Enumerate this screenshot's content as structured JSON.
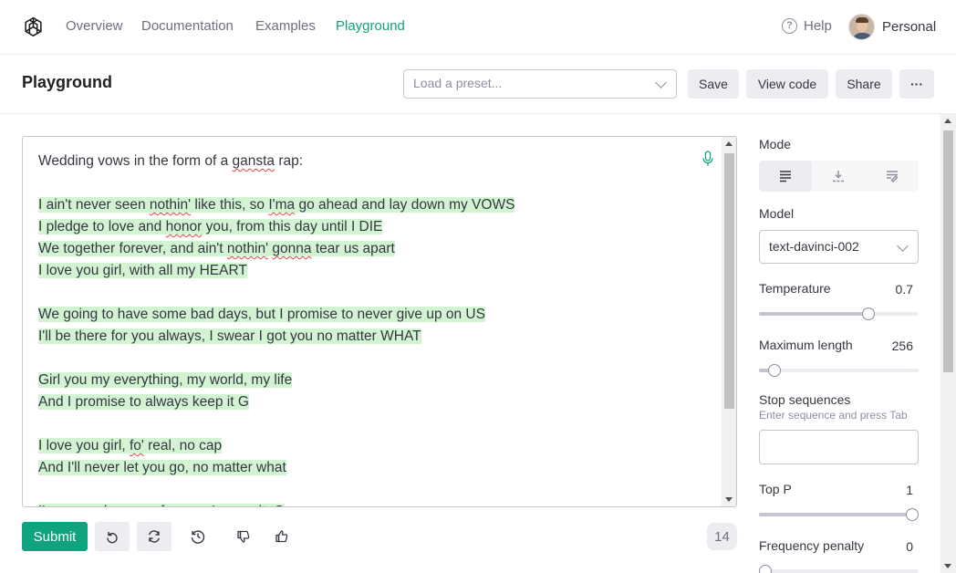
{
  "nav": {
    "links": [
      "Overview",
      "Documentation",
      "Examples",
      "Playground"
    ],
    "active": "Playground",
    "help": "Help",
    "account": "Personal"
  },
  "header": {
    "title": "Playground",
    "preset_placeholder": "Load a preset...",
    "save": "Save",
    "view_code": "View code",
    "share": "Share",
    "more": "···"
  },
  "editor": {
    "lines": [
      [
        {
          "t": "Wedding vows in the form of a ",
          "g": false
        },
        {
          "t": "gansta",
          "g": false,
          "sq": true
        },
        {
          "t": " rap:",
          "g": false
        }
      ],
      [],
      [
        {
          "t": "I ain't never seen ",
          "g": true
        },
        {
          "t": "nothin'",
          "g": true,
          "sq": true
        },
        {
          "t": " like this, so ",
          "g": true
        },
        {
          "t": "I'ma",
          "g": true,
          "sq": true
        },
        {
          "t": " go ahead and lay down my VOWS",
          "g": true
        }
      ],
      [
        {
          "t": "I pledge to love and ",
          "g": true
        },
        {
          "t": "honor",
          "g": true,
          "sq": true
        },
        {
          "t": " you, from this day until I DIE",
          "g": true
        }
      ],
      [
        {
          "t": "We together forever, and ain't ",
          "g": true
        },
        {
          "t": "nothin'",
          "g": true,
          "sq": true
        },
        {
          "t": " ",
          "g": true
        },
        {
          "t": "gonna",
          "g": true,
          "sq": true
        },
        {
          "t": " tear us apart",
          "g": true
        }
      ],
      [
        {
          "t": "I love you girl, with all my HEART",
          "g": true
        }
      ],
      [],
      [
        {
          "t": "We going to have some bad days, but I promise to never give up on US",
          "g": true
        }
      ],
      [
        {
          "t": "I'll be there for you always, I swear I got you no matter WHAT",
          "g": true
        }
      ],
      [],
      [
        {
          "t": "Girl you my everything, my world, my life",
          "g": true
        }
      ],
      [
        {
          "t": "And I promise to always keep it G",
          "g": true
        }
      ],
      [],
      [
        {
          "t": "I love you girl, ",
          "g": true
        },
        {
          "t": "fo'",
          "g": true,
          "sq": true
        },
        {
          "t": " real, no cap",
          "g": true
        }
      ],
      [
        {
          "t": "And I'll never let you go, no matter what",
          "g": true
        }
      ],
      [],
      [
        {
          "t": "I'm gonna love you forever, I mean it, G",
          "g": true
        }
      ]
    ]
  },
  "toolbar": {
    "submit": "Submit",
    "token_count": "14"
  },
  "panel": {
    "mode_label": "Mode",
    "model_label": "Model",
    "model_value": "text-davinci-002",
    "temperature_label": "Temperature",
    "temperature_value": "0.7",
    "max_length_label": "Maximum length",
    "max_length_value": "256",
    "stop_label": "Stop sequences",
    "stop_hint": "Enter sequence and press Tab",
    "top_p_label": "Top P",
    "top_p_value": "1",
    "freq_label": "Frequency penalty",
    "freq_value": "0"
  },
  "sliders": {
    "temperature": 0.7,
    "max_length": 0.06,
    "top_p": 1.0,
    "frequency": 0.0
  },
  "colors": {
    "accent": "#10a37f",
    "generated_highlight": "#d2f4d3",
    "spellcheck": "#e0443e"
  }
}
